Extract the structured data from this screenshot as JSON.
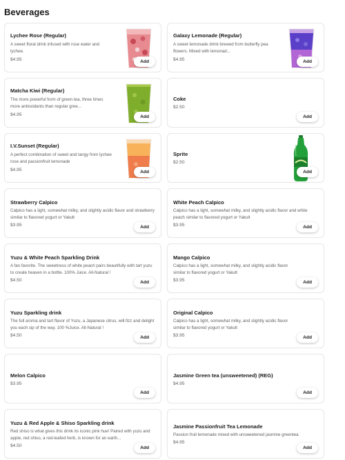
{
  "section": {
    "title": "Beverages"
  },
  "add_label": "Add",
  "items": [
    {
      "name": "Lychee Rose (Regular)",
      "desc": "A sweet floral drink infused with rose water and lychee.",
      "price": "$4.95"
    },
    {
      "name": "Galaxy Lemonade (Regular)",
      "desc": "A sweet lemonade drink brewed from butterfly pea flowers. Mixed with lemonad...",
      "price": "$4.95"
    },
    {
      "name": "Matcha Kiwi (Regular)",
      "desc": "The more powerful form of green tea, three times more antioxidants than regular gree...",
      "price": "$4.95"
    },
    {
      "name": "Coke",
      "desc": "",
      "price": "$2.50"
    },
    {
      "name": "I.V.Sunset (Regular)",
      "desc": "A perfect combination of sweet and tangy from lychee rose and passionfruit lemonade",
      "price": "$4.95"
    },
    {
      "name": "Sprite",
      "desc": "",
      "price": "$2.50"
    },
    {
      "name": "Strawberry Calpico",
      "desc": "Calpico has a light, somewhat milky, and slightly acidic flavor and strawberry similar to flavored yogurt or Yakult",
      "price": "$3.95"
    },
    {
      "name": "White Peach Calpico",
      "desc": "Calpico has a light, somewhat milky, and slightly acidic flavor and white peach similar to flavored yogurt or Yakult",
      "price": "$3.95"
    },
    {
      "name": "Yuzu & White Peach Sparkling Drink",
      "desc": "A fan favorite. The sweetness of white peach pairs beautifully with tart yuzu to create heaven in a bottle. 100% Juice. All-Natural !",
      "price": "$4.50"
    },
    {
      "name": "Mango Calpico",
      "desc": "Calpico has a light, somewhat milky, and slightly acidic flavor similar to flavored yogurt or Yakult",
      "price": "$3.95"
    },
    {
      "name": "Yuzu Sparkling drink",
      "desc": "The full aroma and tart flavor of Yuzu, a Japanese citrus, will fizz and delight you each sip of the way. 100 %Juice. All-Natural !",
      "price": "$4.50"
    },
    {
      "name": "Original Calpico",
      "desc": "Calpico has a light, somewhat milky, and slightly acidic flavor similar to flavored yogurt or Yakult",
      "price": "$3.95"
    },
    {
      "name": "Melon Calpico",
      "desc": "",
      "price": "$3.95"
    },
    {
      "name": "Jasmine Green tea (unsweetened) (REG)",
      "desc": "",
      "price": "$4.95"
    },
    {
      "name": "Yuzu & Red Apple & Shiso Sparkling drink",
      "desc": "Red shiso is what gives this drink its iconic pink hue! Paired with yuzu and apple, red shiso, a red-leafed herb, is known for an earth...",
      "price": "$4.50"
    },
    {
      "name": "Jasmine Passionfruit Tea Lemonade",
      "desc": "Passion fruit lemonade mixed with unsweetened jasmine greentea",
      "price": "$4.95"
    }
  ]
}
